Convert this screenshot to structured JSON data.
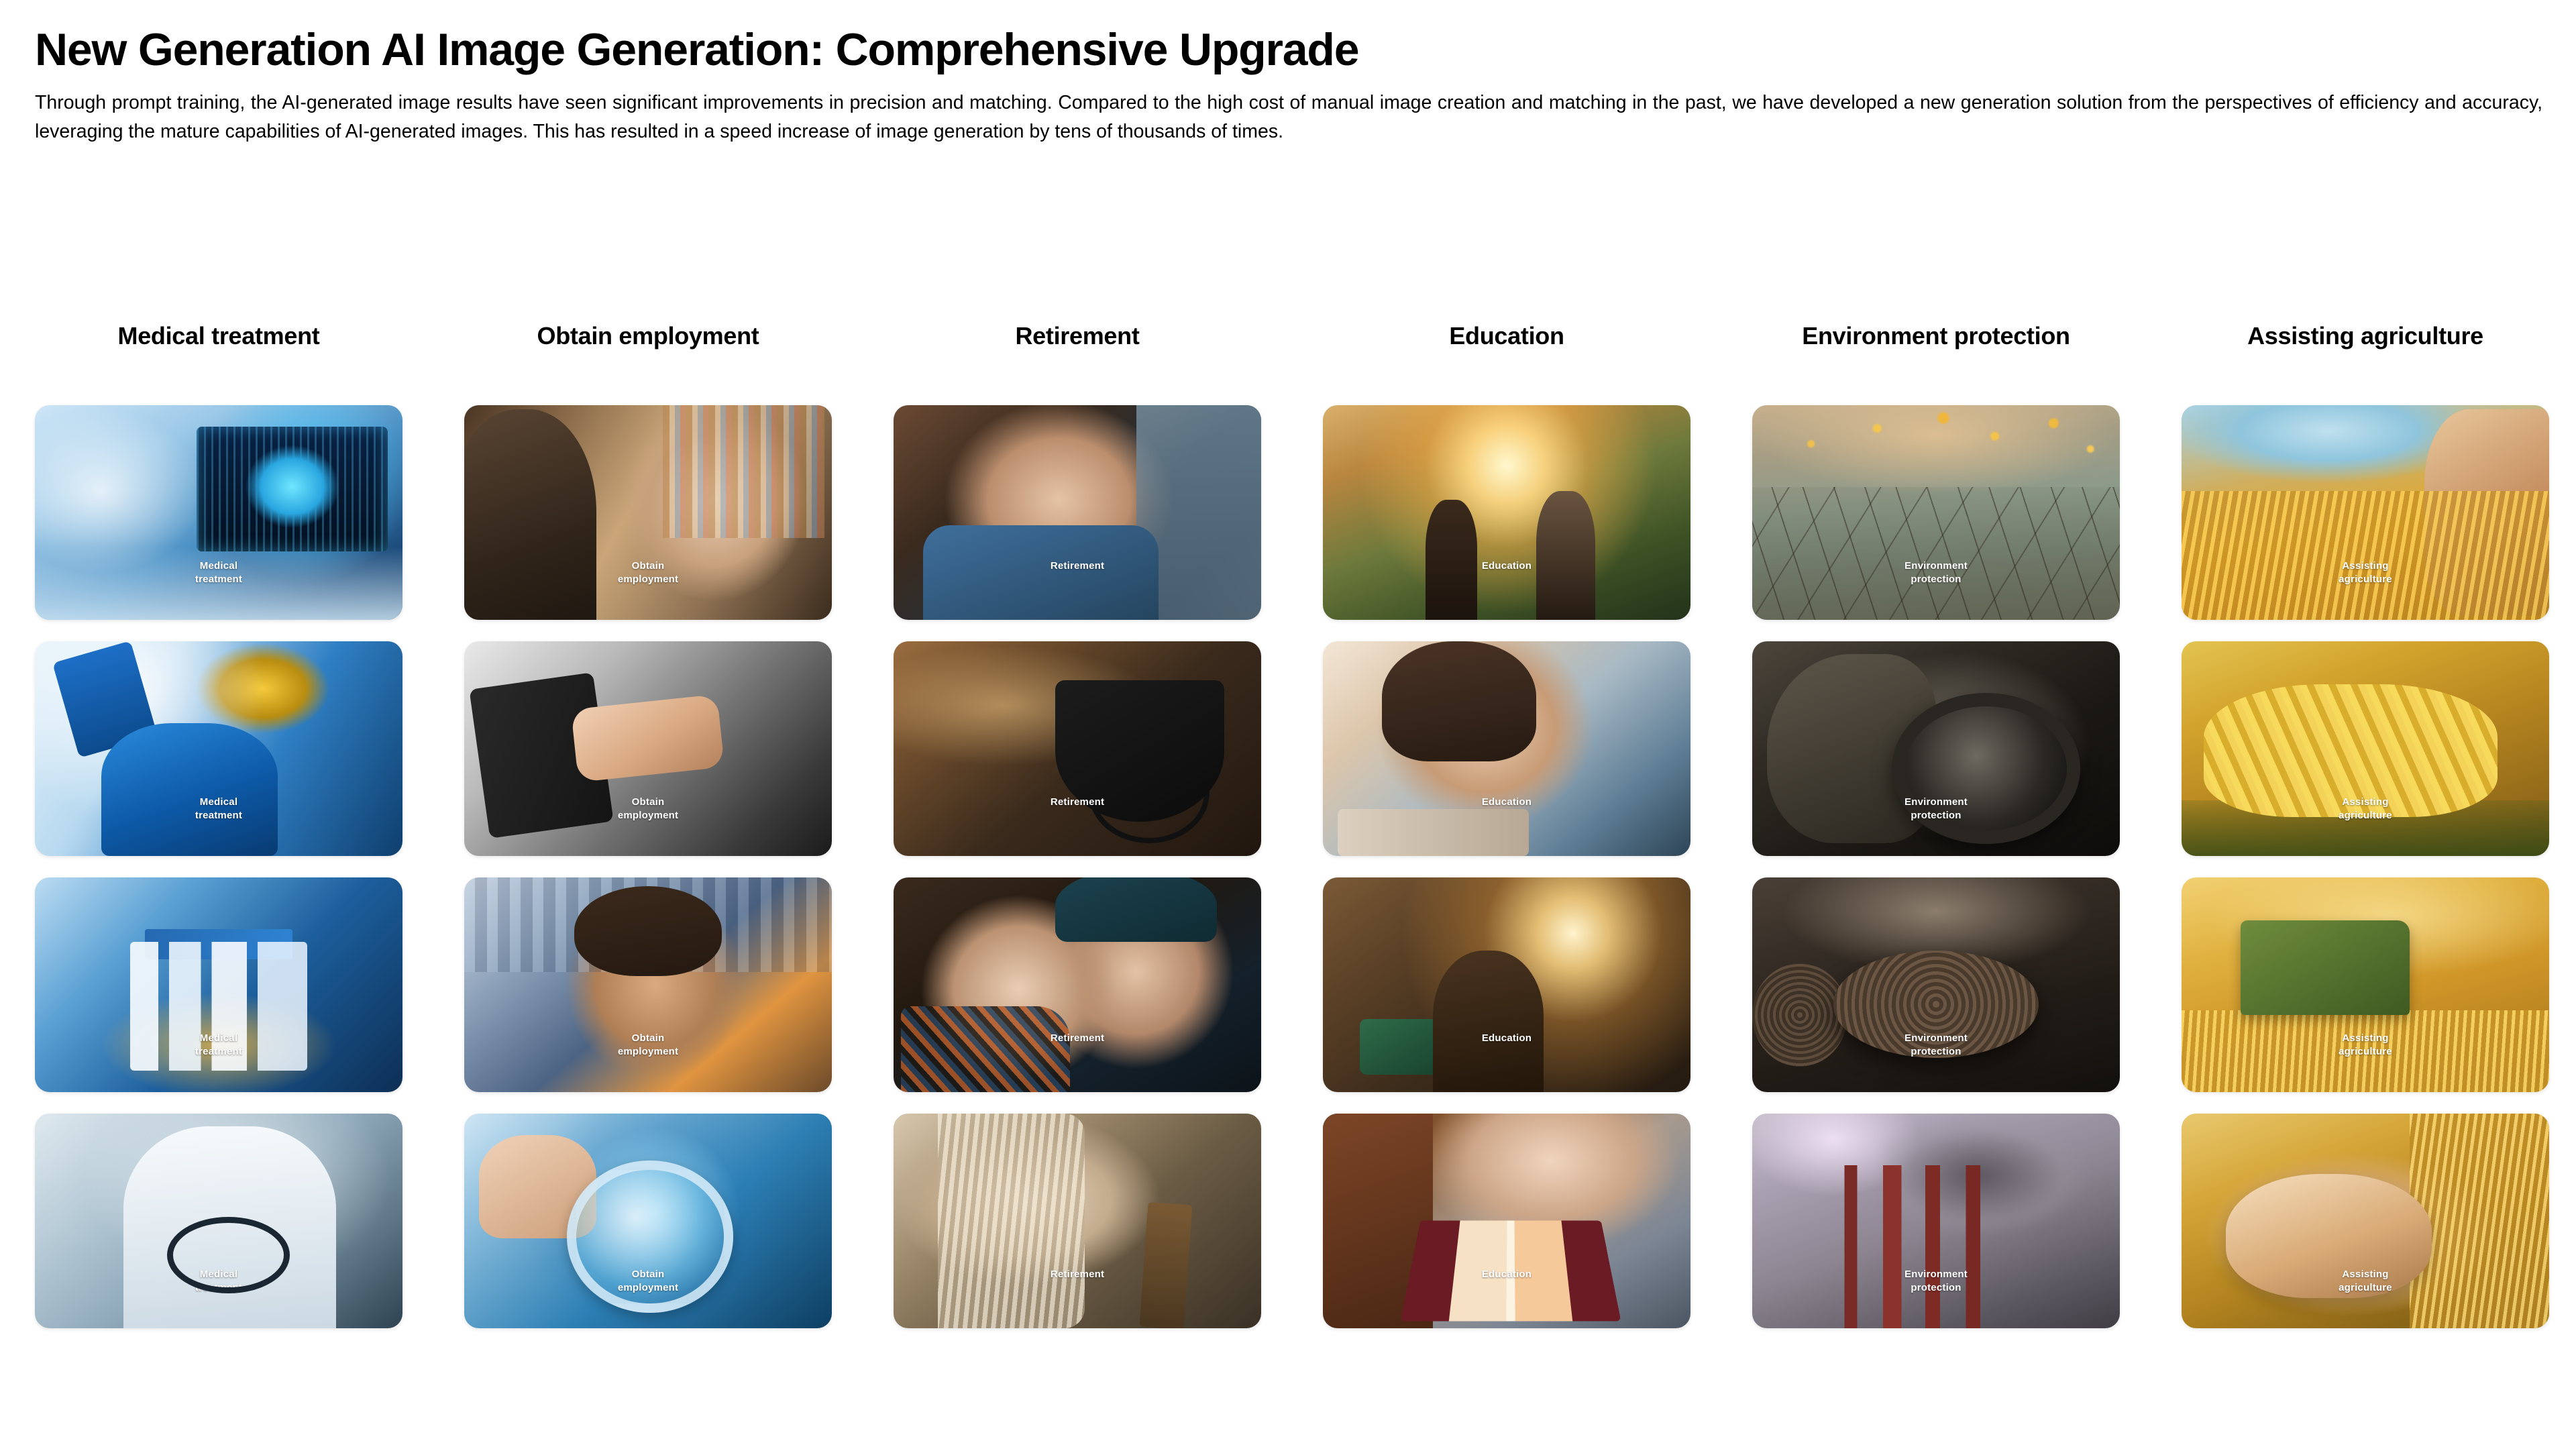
{
  "header": {
    "title": "New Generation AI Image Generation: Comprehensive Upgrade",
    "description": "Through prompt training, the AI-generated image results have seen significant improvements in precision and matching. Compared to the high cost of manual image creation and matching in the past, we have developed a new generation solution from the perspectives of efficiency and accuracy, leveraging the mature capabilities of AI-generated images. This has resulted in a speed increase of image generation by tens of thousands of times."
  },
  "gallery": {
    "columns": [
      {
        "title": "Medical treatment",
        "watermark": "Medical\ntreatment",
        "cards": [
          {
            "scene": "s-mri",
            "caption": "Medical treatment",
            "alt": "MRI brain scan on medical monitor in hospital control room"
          },
          {
            "scene": "s-lab",
            "caption": "Medical treatment",
            "alt": "Scientist in blue gloves and safety goggles handling test tubes"
          },
          {
            "scene": "s-pharm",
            "caption": "Medical treatment",
            "alt": "Pharmaceutical bottles and medicine vials on a lab bench"
          },
          {
            "scene": "s-doctor",
            "caption": "Medical treatment",
            "alt": "Doctor in white coat holding a stethoscope"
          }
        ]
      },
      {
        "title": "Obtain employment",
        "watermark": "Obtain\nemployment",
        "cards": [
          {
            "scene": "s-interview",
            "caption": "Obtain employment",
            "alt": "Young woman in a job interview in front of bookshelves"
          },
          {
            "scene": "s-handshake",
            "caption": "Obtain employment",
            "alt": "Black and white handshake between two people in suits"
          },
          {
            "scene": "s-graduate",
            "caption": "Obtain employment",
            "alt": "Smiling young graduate with glasses outdoors"
          },
          {
            "scene": "s-magnify",
            "caption": "Obtain employment",
            "alt": "Hand holding a magnifying glass over a blue background"
          }
        ]
      },
      {
        "title": "Retirement",
        "watermark": "Retirement",
        "cards": [
          {
            "scene": "s-elder1",
            "caption": "Retirement",
            "alt": "Elderly man in denim shirt resting his head on his arm"
          },
          {
            "scene": "s-wheelchair",
            "caption": "Retirement",
            "alt": "Empty wheelchair on an autumn street with fallen leaves"
          },
          {
            "scene": "s-couple",
            "caption": "Retirement",
            "alt": "Elderly couple leaning close together wearing winter clothes"
          },
          {
            "scene": "s-cane",
            "caption": "Retirement",
            "alt": "Elderly hand gripping a wooden walking cane"
          }
        ]
      },
      {
        "title": "Education",
        "watermark": "Education",
        "cards": [
          {
            "scene": "s-family",
            "caption": "Education",
            "alt": "Family with a child walking down a sunlit path"
          },
          {
            "scene": "s-study",
            "caption": "Education",
            "alt": "Young woman studying with books at a desk"
          },
          {
            "scene": "s-lamp",
            "caption": "Education",
            "alt": "Student seated at a desk under a warm lamp"
          },
          {
            "scene": "s-reading",
            "caption": "Education",
            "alt": "Adult and child reading an open book together"
          }
        ]
      },
      {
        "title": "Environment protection",
        "watermark": "Environment\nprotection",
        "cards": [
          {
            "scene": "s-cracked",
            "caption": "Environment protection",
            "alt": "Dry cracked earth with sparse sprouts and golden bokeh"
          },
          {
            "scene": "s-gasmask",
            "caption": "Environment protection",
            "alt": "Close up of a gas mask respirator filter"
          },
          {
            "scene": "s-stumps",
            "caption": "Environment protection",
            "alt": "Cut tree stumps showing growth rings after deforestation"
          },
          {
            "scene": "s-smoke",
            "caption": "Environment protection",
            "alt": "Industrial smokestacks releasing dark smoke into the sky"
          }
        ]
      },
      {
        "title": "Assisting agriculture",
        "watermark": "Assisting\nagriculture",
        "cards": [
          {
            "scene": "s-wheat",
            "caption": "Assisting agriculture",
            "alt": "Hand touching golden wheat ears in a field with mountains"
          },
          {
            "scene": "s-corn",
            "caption": "Assisting agriculture",
            "alt": "Basket of freshly harvested corn cobs"
          },
          {
            "scene": "s-tractor",
            "caption": "Assisting agriculture",
            "alt": "Green combine harvester working in a golden wheat field"
          },
          {
            "scene": "s-grain",
            "caption": "Assisting agriculture",
            "alt": "Cupped hands holding golden grain in a wheat field"
          }
        ]
      }
    ]
  },
  "colors": {
    "background": "#ffffff",
    "text": "#000000",
    "watermark": "#ffffff"
  }
}
